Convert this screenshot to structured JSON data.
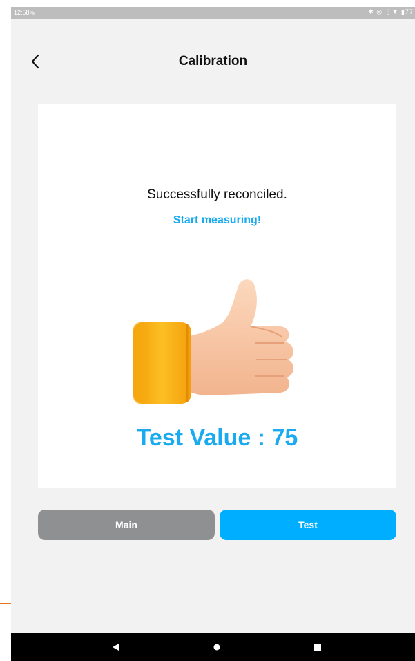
{
  "status_bar": {
    "time": "12:58",
    "time_suffix": "PM",
    "battery": "77"
  },
  "header": {
    "title": "Calibration",
    "back_icon": "chevron-left-icon"
  },
  "card": {
    "message": "Successfully reconciled.",
    "subtitle": "Start measuring!",
    "illustration": "thumbs-up-icon",
    "value_text": "Test Value : 75"
  },
  "buttons": {
    "main_label": "Main",
    "test_label": "Test"
  },
  "nav": {
    "back": "back-triangle-icon",
    "home": "home-circle-icon",
    "recents": "recents-square-icon"
  },
  "colors": {
    "accent": "#19aaf0",
    "button_active": "#00aeff",
    "button_inactive": "#8e9092",
    "background": "#f2f2f2"
  }
}
